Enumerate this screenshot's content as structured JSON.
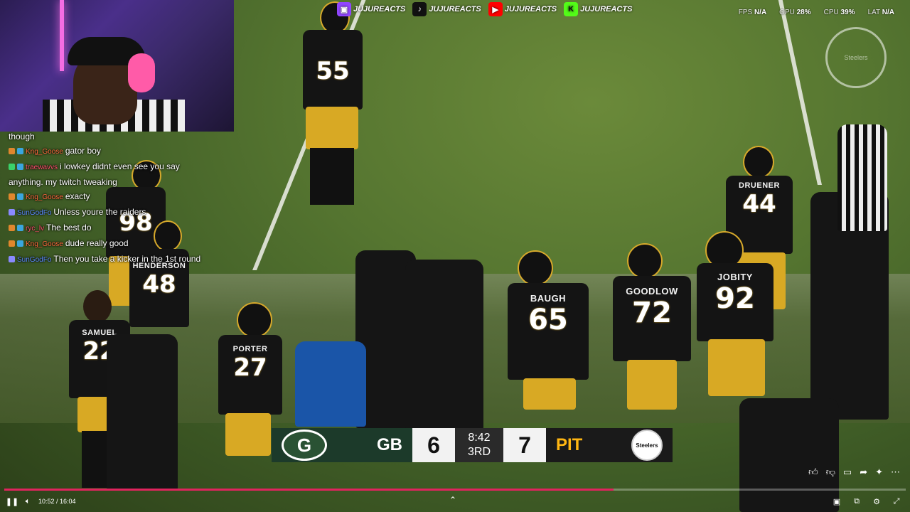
{
  "social": [
    {
      "platform": "twitch-icon",
      "glyph": "▣",
      "handle": "JUJUREACTS",
      "color": "#9146ff"
    },
    {
      "platform": "tiktok-icon",
      "glyph": "♪",
      "handle": "JUJUREACTS",
      "color": "#111111"
    },
    {
      "platform": "youtube-icon",
      "glyph": "▶",
      "handle": "JUJUREACTS",
      "color": "#ff0000"
    },
    {
      "platform": "kick-icon",
      "glyph": "K",
      "handle": "JUJUREACTS",
      "color": "#53fc18"
    }
  ],
  "stats": {
    "fps_label": "FPS",
    "fps": "N/A",
    "gpu_label": "GPU",
    "gpu": "28%",
    "cpu_label": "CPU",
    "cpu": "39%",
    "lat_label": "LAT",
    "lat": "N/A"
  },
  "watermark": "Steelers",
  "chat": [
    {
      "user": "",
      "text": "though",
      "color": "#ffffff"
    },
    {
      "user": "Kng_Goose",
      "text": "gator boy",
      "color": "#ff6a3d"
    },
    {
      "user": "traewavvs",
      "text": "i lowkey didnt even see you say",
      "color": "#ff4f6d"
    },
    {
      "user": "",
      "text": "anything. my twitch tweaking",
      "color": "#ffffff"
    },
    {
      "user": "Kng_Goose",
      "text": "exacty",
      "color": "#ff6a3d"
    },
    {
      "user": "SunGodFo",
      "text": "Unless youre the raiders",
      "color": "#5b8bff"
    },
    {
      "user": "ryc_lv",
      "text": "The best do",
      "color": "#ff4f6d"
    },
    {
      "user": "Kng_Goose",
      "text": "dude really good",
      "color": "#ff6a3d"
    },
    {
      "user": "SunGodFo",
      "text": "Then you take a kicker in the 1st round",
      "color": "#5b8bff"
    }
  ],
  "players": {
    "p55": {
      "num": "55",
      "name": ""
    },
    "p44": {
      "num": "44",
      "name": "DRUENER"
    },
    "p48": {
      "num": "48",
      "name": "HENDERSON"
    },
    "p22": {
      "num": "22",
      "name": "SAMUEL"
    },
    "p27": {
      "num": "27",
      "name": "PORTER"
    },
    "p65": {
      "num": "65",
      "name": "BAUGH"
    },
    "p72": {
      "num": "72",
      "name": "GOODLOW"
    },
    "p92": {
      "num": "92",
      "name": "JOBITY"
    },
    "p98": {
      "num": "98",
      "name": ""
    }
  },
  "scorebug": {
    "away_logo": "G",
    "away_team": "GB",
    "away_score": "6",
    "clock": "8:42",
    "quarter": "3RD",
    "home_score": "7",
    "home_team": "PIT",
    "home_logo": "Steelers"
  },
  "player": {
    "time": "10:52 / 16:04",
    "progress": 0.676
  }
}
